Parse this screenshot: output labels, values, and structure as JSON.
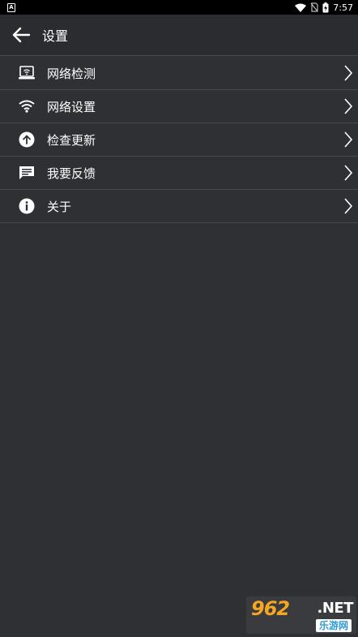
{
  "status_bar": {
    "notification_icon_label": "A",
    "time": "7:57",
    "icons": [
      "notification-icon",
      "wifi-icon",
      "no-sim-icon",
      "battery-charging-icon"
    ]
  },
  "app_bar": {
    "title": "设置",
    "back_icon": "arrow-left-icon"
  },
  "menu": {
    "items": [
      {
        "label": "网络检测",
        "icon": "network-check-icon"
      },
      {
        "label": "网络设置",
        "icon": "wifi-icon"
      },
      {
        "label": "检查更新",
        "icon": "upload-arrow-icon"
      },
      {
        "label": "我要反馈",
        "icon": "feedback-message-icon"
      },
      {
        "label": "关于",
        "icon": "info-icon"
      }
    ],
    "chevron_icon": "chevron-right-icon"
  },
  "watermark": {
    "number": "962",
    "suffix": ".NET",
    "site_name": "乐游网"
  },
  "colors": {
    "background": "#2f3033",
    "app_bar": "#2b2c2f",
    "divider": "#4a4b4f",
    "status_bar": "#000000",
    "text": "#ffffff"
  }
}
